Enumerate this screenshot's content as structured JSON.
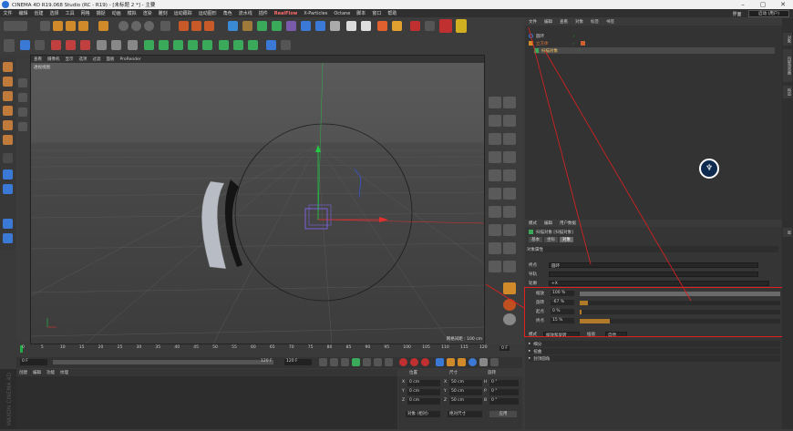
{
  "window": {
    "title": "CINEMA 4D R19.068 Studio (RC - R19) - [未标题 2 *] - 主要",
    "controls": [
      "–",
      "▢",
      "✕"
    ]
  },
  "menubar": {
    "items": [
      "文件",
      "编辑",
      "创建",
      "选择",
      "工具",
      "网格",
      "捕捉",
      "动画",
      "模拟",
      "渲染",
      "雕刻",
      "运动跟踪",
      "运动图形",
      "角色",
      "流水线",
      "插件",
      "RealFlow",
      "X-Particles",
      "Octane",
      "脚本",
      "窗口",
      "帮助"
    ],
    "interface_label": "界面",
    "interface_value": "启动 (用户)"
  },
  "viewport": {
    "menu": [
      "查看",
      "摄像机",
      "显示",
      "选项",
      "过滤",
      "面板",
      "ProRender"
    ],
    "view_label": "透视视图",
    "grid_label": "网格间距 : 100 cm"
  },
  "timeline": {
    "ticks": [
      "0",
      "5",
      "10",
      "15",
      "20",
      "25",
      "30",
      "35",
      "40",
      "45",
      "50",
      "55",
      "60",
      "65",
      "70",
      "75",
      "80",
      "85",
      "90",
      "95",
      "100",
      "105",
      "110",
      "115",
      "120"
    ],
    "current_frame": "0 F",
    "start_frame": "0 F",
    "end_frame": "120 F",
    "end_frame2": "120 F"
  },
  "material_manager": {
    "menu": [
      "创建",
      "编辑",
      "功能",
      "纹理"
    ]
  },
  "coords": {
    "headers": [
      "位置",
      "尺寸",
      "旋转"
    ],
    "rows": [
      {
        "axis": "X",
        "pos": "0 cm",
        "size_axis": "X",
        "size": "50 cm",
        "rot_axis": "H",
        "rot": "0 °"
      },
      {
        "axis": "Y",
        "pos": "0 cm",
        "size_axis": "Y",
        "size": "50 cm",
        "rot_axis": "P",
        "rot": "0 °"
      },
      {
        "axis": "Z",
        "pos": "0 cm",
        "size_axis": "Z",
        "size": "50 cm",
        "rot_axis": "B",
        "rot": "0 °"
      }
    ],
    "mode_select": "对象 (相对)",
    "size_select": "绝对尺寸",
    "apply_button": "应用"
  },
  "object_manager": {
    "menu": [
      "文件",
      "编辑",
      "查看",
      "对象",
      "标签",
      "书签"
    ],
    "objects": [
      {
        "name": "圆环"
      },
      {
        "name": "立方体"
      },
      {
        "name": "扫描对象"
      }
    ]
  },
  "attribute_manager": {
    "menu": [
      "模式",
      "编辑",
      "用户数据"
    ],
    "object_title": "扫描对象 [扫描对象]",
    "tabs": [
      "基本",
      "坐标",
      "对象"
    ],
    "section_title": "对象属性",
    "fields": [
      {
        "label": "终点",
        "value": "圆环"
      },
      {
        "label": "导轨",
        "value": ""
      },
      {
        "label": "轮廓",
        "value": "+X"
      }
    ],
    "sliders": [
      {
        "label": "缩放",
        "value": "100 %",
        "fraction": 1.0
      },
      {
        "label": "旋转",
        "value": "-67 %",
        "fraction": 0.04
      },
      {
        "label": "起点",
        "value": "0 %",
        "fraction": 0.0
      },
      {
        "label": "终点",
        "value": "15 %",
        "fraction": 0.15
      }
    ],
    "modes_label": "模式",
    "mode_value": "缩放和旋转",
    "interp_label": "插值",
    "interp_value": "自然",
    "collapsibles": [
      "细分",
      "扭曲",
      "封顶圆角"
    ]
  },
  "side_tabs": [
    "对象",
    "内容浏览器",
    "构造",
    "层"
  ],
  "colors": {
    "accent_red": "#e02020",
    "axis_green": "#22cc44",
    "axis_red": "#e03030",
    "axis_blue": "#3355ff",
    "slider_orange": "#b07a2a"
  }
}
